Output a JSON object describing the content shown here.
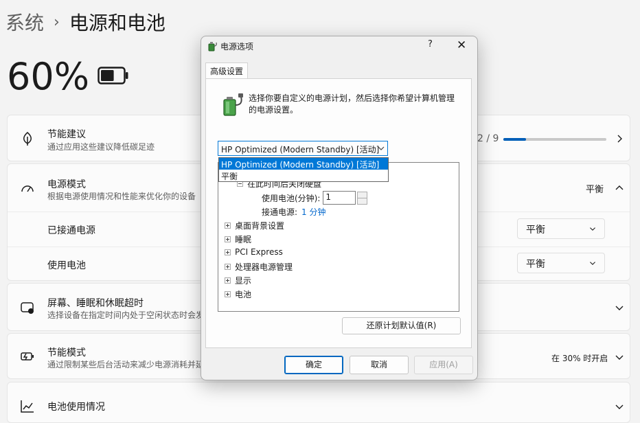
{
  "breadcrumb": {
    "parent": "系统",
    "separator": "›",
    "current": "电源和电池"
  },
  "battery": {
    "percent": "60%",
    "level": 0.6
  },
  "rows": {
    "energy_rec": {
      "title": "节能建议",
      "subtitle": "通过应用这些建议降低碳足迹",
      "progress_text": "2 / 9",
      "progress": 0.22
    },
    "power_mode": {
      "title": "电源模式",
      "subtitle": "根据电源使用情况和性能来优化你的设备",
      "value": "平衡"
    },
    "plugged_in": {
      "label": "已接通电源",
      "value": "平衡"
    },
    "on_battery": {
      "label": "使用电池",
      "value": "平衡"
    },
    "screen_sleep": {
      "title": "屏幕、睡眠和休眠超时",
      "subtitle": "选择设备在指定时间内处于空闲状态时会发"
    },
    "energy_saver": {
      "title": "节能模式",
      "subtitle": "通过限制某些后台活动来减少电源消耗并延",
      "value": "在 30% 时开启"
    },
    "battery_usage": {
      "title": "电池使用情况"
    }
  },
  "dialog": {
    "title": "电源选项",
    "help": "?",
    "close": "✕",
    "tab": "高级设置",
    "description": "选择你要自定义的电源计划，然后选择你希望计算机管理的电源设置。",
    "plan_selected": "HP Optimized (Modern Standby) [活动]",
    "plan_options": [
      "HP Optimized (Modern Standby) [活动]",
      "平衡"
    ],
    "tree": {
      "partial_item": "在此时间后关闭硬盘",
      "battery_label": "使用电池(分钟):",
      "battery_value": "1",
      "plugged_label": "接通电源:",
      "plugged_value": "1 分钟",
      "items": [
        "桌面背景设置",
        "睡眠",
        "PCI Express",
        "处理器电源管理",
        "显示",
        "电池"
      ]
    },
    "restore_button": "还原计划默认值(R)",
    "ok_button": "确定",
    "cancel_button": "取消",
    "apply_button": "应用(A)"
  }
}
